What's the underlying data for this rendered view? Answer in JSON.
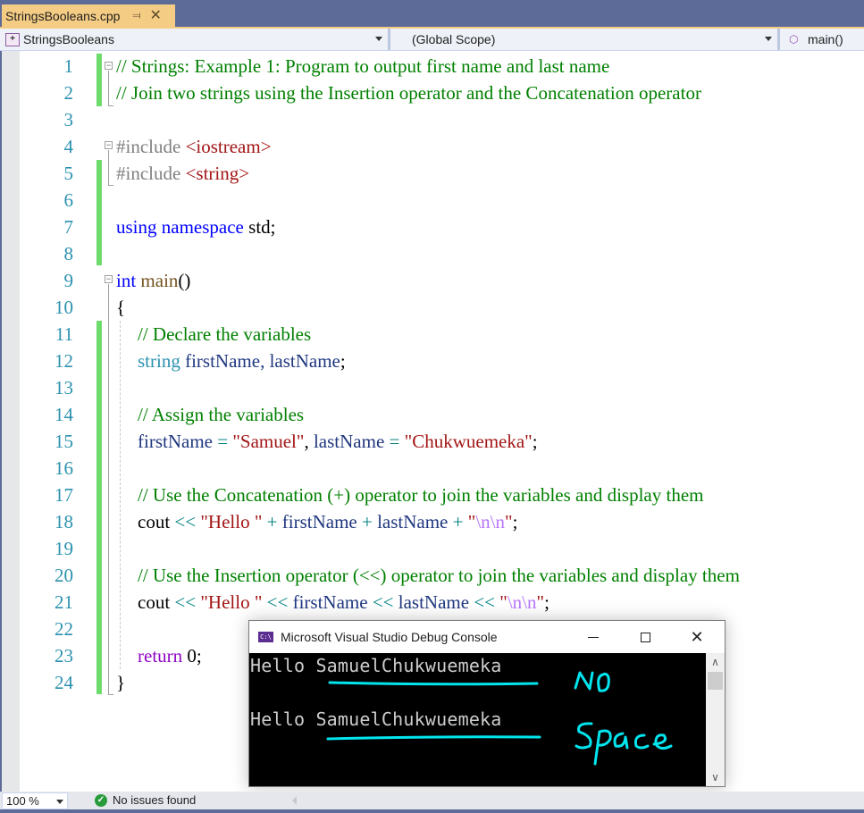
{
  "tab": {
    "filename": "StringsBooleans.cpp",
    "pin_icon": "pin-icon",
    "close_icon": "close-icon"
  },
  "navbar": {
    "project": "StringsBooleans",
    "scope": "(Global Scope)",
    "member": "main()"
  },
  "editor": {
    "line_numbers": [
      "1",
      "2",
      "3",
      "4",
      "5",
      "6",
      "7",
      "8",
      "9",
      "10",
      "11",
      "12",
      "13",
      "14",
      "15",
      "16",
      "17",
      "18",
      "19",
      "20",
      "21",
      "22",
      "23",
      "24"
    ],
    "lines": {
      "l1": "// Strings: Example 1: Program to output first name and last name",
      "l2": "// Join two strings using the Insertion operator and the Concatenation operator",
      "l4_directive": "#include",
      "l4_header": "<iostream>",
      "l5_directive": "#include",
      "l5_header": "<string>",
      "l7_using": "using",
      "l7_namespace": "namespace",
      "l7_std": "std;",
      "l9_int": "int",
      "l9_main": "main",
      "l9_parens": "()",
      "l10": "{",
      "l11": "// Declare the variables",
      "l12_type": "string",
      "l12_vars": "firstName, lastName",
      "l12_semi": ";",
      "l14": "// Assign the variables",
      "l15_var1": "firstName",
      "l15_eq1": " = ",
      "l15_str1": "\"Samuel\"",
      "l15_comma": ", ",
      "l15_var2": "lastName",
      "l15_eq2": " = ",
      "l15_str2": "\"Chukwuemeka\"",
      "l15_semi": ";",
      "l17": "// Use the Concatenation (+) operator to join the variables and display them",
      "l18_cout": "cout",
      "l18_op1": " << ",
      "l18_str": "\"Hello \"",
      "l18_plus1": " + ",
      "l18_v1": "firstName",
      "l18_plus2": " + ",
      "l18_v2": "lastName",
      "l18_plus3": " + ",
      "l18_q1": "\"",
      "l18_esc": "\\n\\n",
      "l18_q2": "\"",
      "l18_semi": ";",
      "l20": "// Use the Insertion operator (<<) operator to join the variables and display them",
      "l21_cout": "cout",
      "l21_op1": " << ",
      "l21_str": "\"Hello \"",
      "l21_op2": " << ",
      "l21_v1": "firstName",
      "l21_op3": " << ",
      "l21_v2": "lastName",
      "l21_op4": " << ",
      "l21_q1": "\"",
      "l21_esc": "\\n\\n",
      "l21_q2": "\"",
      "l21_semi": ";",
      "l23_return": "return",
      "l23_value": " 0;",
      "l24": "}"
    }
  },
  "status": {
    "zoom": "100 %",
    "issues": "No issues found"
  },
  "console": {
    "title": "Microsoft Visual Studio Debug Console",
    "icon_label": "C:\\",
    "output": [
      "Hello SamuelChukwuemeka",
      "Hello SamuelChukwuemeka"
    ],
    "annotation": {
      "line1": "NO",
      "line2": "Space",
      "color": "#00e5ee"
    }
  },
  "colors": {
    "accent_tab": "#f5cc84",
    "frame": "#5d6b99",
    "change_bar": "#6ddc6c",
    "comment": "#008000",
    "keyword": "#0000ff",
    "string": "#a31515"
  }
}
